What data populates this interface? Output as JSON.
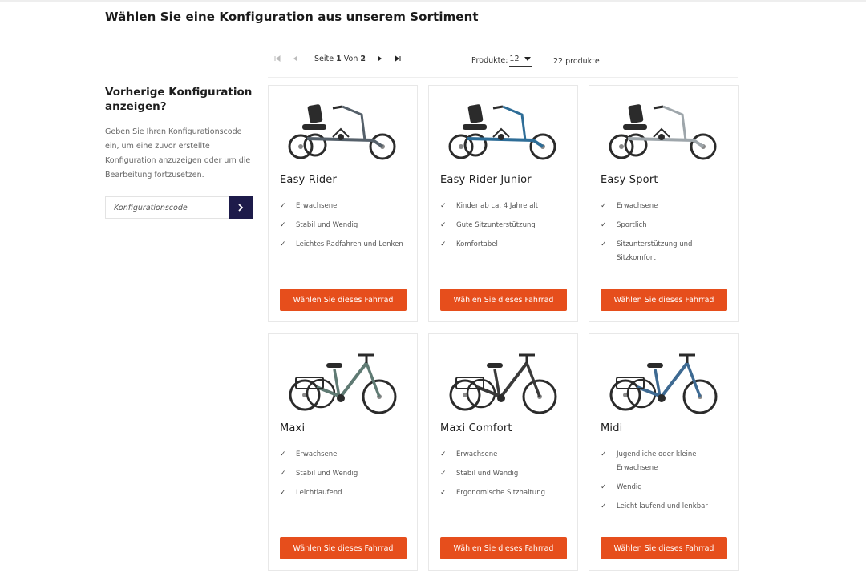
{
  "page_title": "Wählen Sie eine Konfiguration aus unserem Sortiment",
  "sidebar": {
    "heading": "Vorherige Konfiguration anzeigen?",
    "text": "Geben Sie Ihren Konfigurationscode ein, um eine zuvor erstellte Konfiguration anzuzeigen oder um die Bearbeitung fortzusetzen.",
    "input_placeholder": "Konfigurationscode",
    "submit_icon": "chevron-right-icon"
  },
  "pager": {
    "seite": "Seite",
    "current": "1",
    "von": "Von",
    "total": "2",
    "icons": [
      "first-page-icon",
      "prev-page-icon",
      "next-page-icon",
      "last-page-icon"
    ]
  },
  "per_page": {
    "label": "Produkte:",
    "value": "12"
  },
  "count": "22 produkte",
  "colors": {
    "accent": "#e64e1c",
    "submit": "#1d1b4a"
  },
  "products": [
    {
      "name": "Easy Rider",
      "features": [
        "Erwachsene",
        "Stabil und Wendig",
        "Leichtes Radfahren und Lenken"
      ],
      "button": "Wählen Sie dieses Fahrrad",
      "frame_color": "#55606a"
    },
    {
      "name": "Easy Rider Junior",
      "features": [
        "Kinder ab ca. 4 Jahre alt",
        "Gute Sitzunterstützung",
        "Komfortabel"
      ],
      "button": "Wählen Sie dieses Fahrrad",
      "frame_color": "#2e6d97"
    },
    {
      "name": "Easy Sport",
      "features": [
        "Erwachsene",
        "Sportlich",
        "Sitzunterstützung und Sitzkomfort"
      ],
      "button": "Wählen Sie dieses Fahrrad",
      "frame_color": "#9ea6ab"
    },
    {
      "name": "Maxi",
      "features": [
        "Erwachsene",
        "Stabil und Wendig",
        "Leichtlaufend"
      ],
      "button": "Wählen Sie dieses Fahrrad",
      "frame_color": "#5f7a73"
    },
    {
      "name": "Maxi Comfort",
      "features": [
        "Erwachsene",
        "Stabil und Wendig",
        "Ergonomische Sitzhaltung"
      ],
      "button": "Wählen Sie dieses Fahrrad",
      "frame_color": "#3a3a3a"
    },
    {
      "name": "Midi",
      "features": [
        "Jugendliche oder kleine Erwachsene",
        "Wendig",
        "Leicht laufend und lenkbar"
      ],
      "button": "Wählen Sie dieses Fahrrad",
      "frame_color": "#3e6a92"
    }
  ]
}
